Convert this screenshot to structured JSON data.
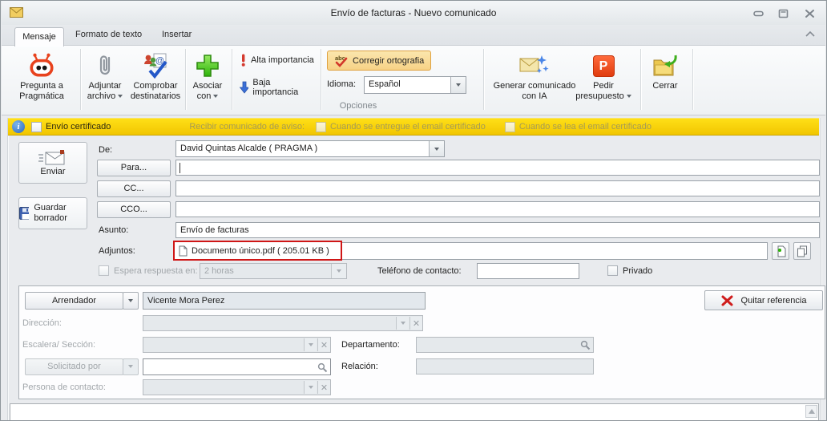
{
  "window": {
    "title": "Envío de facturas - Nuevo comunicado"
  },
  "tabs": {
    "mensaje": "Mensaje",
    "formato": "Formato de texto",
    "insertar": "Insertar"
  },
  "ribbon": {
    "pregunta": "Pregunta a Pragmática",
    "adjuntar": "Adjuntar archivo",
    "comprobar": "Comprobar destinatarios",
    "asociar": "Asociar con",
    "alta": "Alta importancia",
    "baja": "Baja importancia",
    "corregir": "Corregir ortografia",
    "idioma_label": "Idioma:",
    "idioma_value": "Español",
    "opciones": "Opciones",
    "generar": "Generar comunicado con IA",
    "pedir": "Pedir presupuesto",
    "cerrar": "Cerrar"
  },
  "certified_bar": {
    "envio": "Envío certificado",
    "recibir": "Recibir comunicado de aviso:",
    "entregue": "Cuando se entregue el email certificado",
    "lea": "Cuando se lea el email certificado"
  },
  "compose": {
    "enviar": "Enviar",
    "guardar_borrador": "Guardar borrador",
    "de_label": "De:",
    "de_value": "David Quintas Alcalde ( PRAGMA )",
    "para_button": "Para...",
    "cc_button": "CC...",
    "cco_button": "CCO...",
    "asunto_label": "Asunto:",
    "asunto_value": "Envío de facturas",
    "adjuntos_label": "Adjuntos:",
    "adjunto_file": "Documento único.pdf ( 205.01 KB )",
    "espera_label": "Espera respuesta en:",
    "espera_value": "2 horas",
    "telefono_label": "Teléfono de contacto:",
    "privado_label": "Privado"
  },
  "referencia": {
    "tipo_value": "Arrendador",
    "nombre_value": "Vicente Mora Perez",
    "quitar_button": "Quitar referencia",
    "direccion_label": "Dirección:",
    "escalera_label": "Escalera/ Sección:",
    "departamento_label": "Departamento:",
    "solicitado_button": "Solicitado por",
    "relacion_label": "Relación:",
    "persona_label": "Persona de contacto:"
  },
  "colors": {
    "certified_bar_yellow": "#F5C800",
    "spellcheck_highlight": "#F7D286",
    "attachment_outline_red": "#CF1616",
    "brand_robot_red": "#E8421D",
    "pedir_icon_red": "#EF4416"
  }
}
